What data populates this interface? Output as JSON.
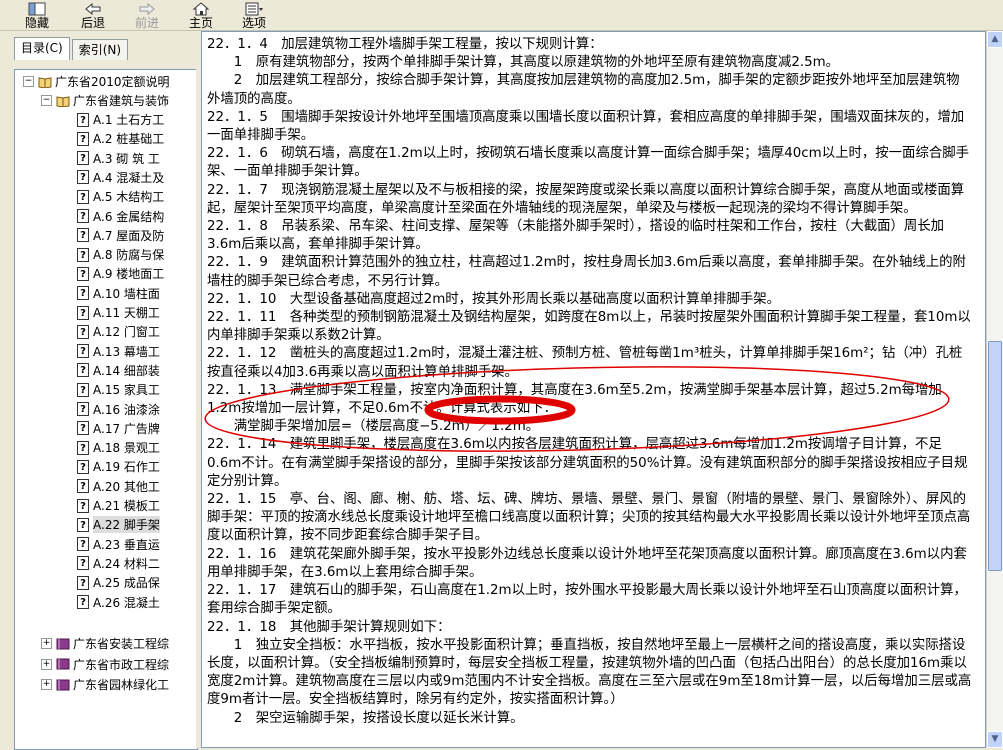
{
  "toolbar": {
    "hide_label": "隐藏",
    "back_label": "后退",
    "forward_label": "前进",
    "home_label": "主页",
    "options_label": "选项"
  },
  "left_tabs": {
    "contents": "目录(C)",
    "index": "索引(N)"
  },
  "tree": {
    "root": "广东省2010定额说明",
    "sub": "广东省建筑与装饰",
    "items": [
      "A.1 土石方工",
      "A.2 桩基础工",
      "A.3 砌 筑 工",
      "A.4 混凝土及",
      "A.5 木结构工",
      "A.6 金属结构",
      "A.7 屋面及防",
      "A.8 防腐与保",
      "A.9 楼地面工",
      "A.10 墙柱面",
      "A.11 天棚工",
      "A.12 门窗工",
      "A.13 幕墙工",
      "A.14 细部装",
      "A.15 家具工",
      "A.16 油漆涂",
      "A.17 广告牌",
      "A.18 景观工",
      "A.19 石作工",
      "A.20 其他工",
      "A.21 模板工",
      "A.22 脚手架",
      "A.23 垂直运",
      "A.24 材料二",
      "A.25 成品保",
      "A.26 混凝土"
    ],
    "others": [
      "广东省安装工程综",
      "广东省市政工程综",
      "广东省园林绿化工"
    ]
  },
  "content": {
    "paragraphs": [
      "22．1．4　加层建筑物工程外墙脚手架工程量，按以下规则计算：",
      "　　1　原有建筑物部分，按两个单排脚手架计算，其高度以原建筑物的外地坪至原有建筑物高度减2.5m。",
      "　　2　加层建筑工程部分，按综合脚手架计算，其高度按加层建筑物的高度加2.5m，脚手架的定额步距按外地坪至加层建筑物外墙顶的高度。",
      "22．1．5　围墙脚手架按设计外地坪至围墙顶高度乘以围墙长度以面积计算，套相应高度的单排脚手架，围墙双面抹灰的，增加一面单排脚手架。",
      "22．1．6　砌筑石墙，高度在1.2m以上时，按砌筑石墙长度乘以高度计算一面综合脚手架；墙厚40cm以上时，按一面综合脚手架、一面单排脚手架计算。",
      "22．1．7　现浇钢筋混凝土屋架以及不与板相接的梁，按屋架跨度或梁长乘以高度以面积计算综合脚手架，高度从地面或楼面算起，屋架计至架顶平均高度，单梁高度计至梁面在外墙轴线的现浇屋架，单梁及与楼板一起现浇的梁均不得计算脚手架。",
      "22．1．8　吊装系梁、吊车梁、柱间支撑、屋架等（未能搭外脚手架时），搭设的临时柱架和工作台，按柱（大截面）周长加3.6m后乘以高，套单排脚手架计算。",
      "22．1．9　建筑面积计算范围外的独立柱，柱高超过1.2m时，按柱身周长加3.6m后乘以高度，套单排脚手架。在外轴线上的附墙柱的脚手架已综合考虑，不另行计算。",
      "22．1．10　大型设备基础高度超过2m时，按其外形周长乘以基础高度以面积计算单排脚手架。",
      "22．1．11　各种类型的预制钢筋混凝土及钢结构屋架，如跨度在8m以上，吊装时按屋架外围面积计算脚手架工程量，套10m以内单排脚手架乘以系数2计算。",
      "22．1．12　凿桩头的高度超过1.2m时，混凝土灌注桩、预制方桩、管桩每凿1m³桩头，计算单排脚手架16m²；钻（冲）孔桩按直径乘以4加3.6再乘以高以面积计算单排脚手架。",
      "22．1．13　满堂脚手架工程量，按室内净面积计算，其高度在3.6m至5.2m，按满堂脚手架基本层计算，超过5.2m每增加1.2m按增加一层计算，不足0.6m不计。计算式表示如下：",
      "　　满堂脚手架增加层=（楼层高度−5.2m）／1.2m。",
      "22．1．14　建筑里脚手架，楼层高度在3.6m以内按各层建筑面积计算，层高超过3.6m每增加1.2m按调增子目计算，不足0.6m不计。在有满堂脚手架搭设的部分，里脚手架按该部分建筑面积的50%计算。没有建筑面积部分的脚手架搭设按相应子目规定分别计算。",
      "22．1．15　亭、台、阁、廊、榭、舫、塔、坛、碑、牌坊、景墙、景壁、景门、景窗（附墙的景壁、景门、景窗除外）、屏风的脚手架：平顶的按滴水线总长度乘设计地坪至檐口线高度以面积计算；尖顶的按其结构最大水平投影周长乘以设计外地坪至顶点高度以面积计算，按不同步距套综合脚手架子目。",
      "22．1．16　建筑花架廊外脚手架，按水平投影外边线总长度乘以设计外地坪至花架顶高度以面积计算。廊顶高度在3.6m以内套用单排脚手架，在3.6m以上套用综合脚手架。",
      "22．1．17　建筑石山的脚手架，石山高度在1.2m以上时，按外围水平投影最大周长乘以设计外地坪至石山顶高度以面积计算，套用综合脚手架定额。",
      "22．1．18　其他脚手架计算规则如下：",
      "　　1　独立安全挡板：水平挡板，按水平投影面积计算；垂直挡板，按自然地坪至最上一层横杆之间的搭设高度，乘以实际搭设长度，以面积计算。（安全挡板编制预算时，每层安全挡板工程量，按建筑物外墙的凹凸面（包括凸出阳台）的总长度加16m乘以宽度2m计算。建筑物高度在三层以内或9m范围内不计安全挡板。高度在三至六层或在9m至18m计算一层，以后每增加三层或高度9m者计一层。安全挡板结算时，除另有约定外，按实搭面积计算。）",
      "　　2　架空运输脚手架，按搭设长度以延长米计算。"
    ]
  },
  "colors": {
    "window_bg": "#ece9d8",
    "annotation": "#e00000",
    "tree_border": "#7f9db9"
  },
  "icons": [
    "hide-icon",
    "back-arrow-icon",
    "forward-arrow-icon",
    "home-icon",
    "options-icon",
    "book-icon",
    "help-page-icon"
  ]
}
